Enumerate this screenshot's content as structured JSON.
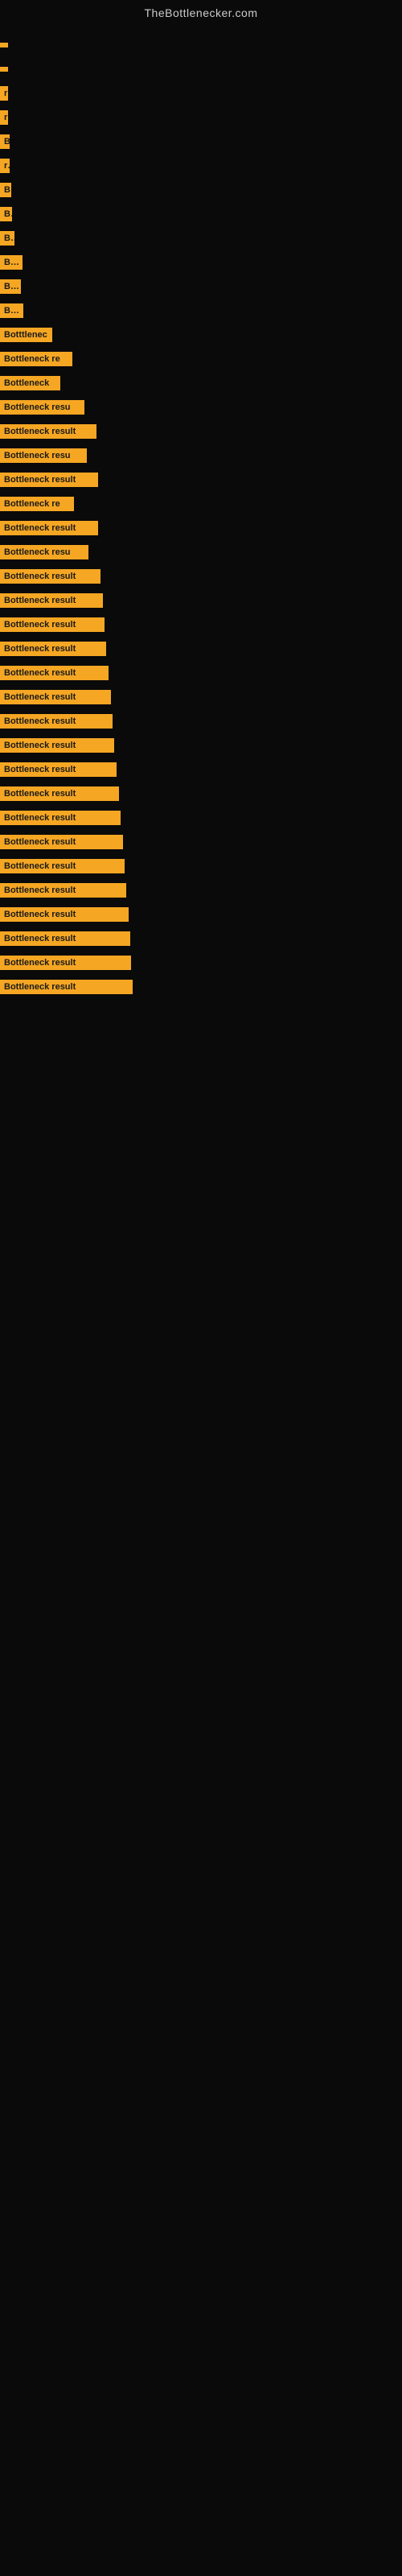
{
  "site": {
    "title": "TheBottlenecker.com"
  },
  "bars": [
    {
      "label": "",
      "width": 5
    },
    {
      "label": "",
      "width": 5
    },
    {
      "label": "r",
      "width": 10
    },
    {
      "label": "r",
      "width": 10
    },
    {
      "label": "B",
      "width": 12
    },
    {
      "label": "r",
      "width": 12
    },
    {
      "label": "B",
      "width": 14
    },
    {
      "label": "B",
      "width": 15
    },
    {
      "label": "Bo",
      "width": 18
    },
    {
      "label": "Bott",
      "width": 28
    },
    {
      "label": "Bot",
      "width": 26
    },
    {
      "label": "Bott",
      "width": 29
    },
    {
      "label": "Botttlenec",
      "width": 65
    },
    {
      "label": "Bottleneck re",
      "width": 90
    },
    {
      "label": "Bottleneck",
      "width": 75
    },
    {
      "label": "Bottleneck resu",
      "width": 105
    },
    {
      "label": "Bottleneck result",
      "width": 120
    },
    {
      "label": "Bottleneck resu",
      "width": 108
    },
    {
      "label": "Bottleneck result",
      "width": 122
    },
    {
      "label": "Bottleneck re",
      "width": 92
    },
    {
      "label": "Bottleneck result",
      "width": 122
    },
    {
      "label": "Bottleneck resu",
      "width": 110
    },
    {
      "label": "Bottleneck result",
      "width": 125
    },
    {
      "label": "Bottleneck result",
      "width": 128
    },
    {
      "label": "Bottleneck result",
      "width": 130
    },
    {
      "label": "Bottleneck result",
      "width": 132
    },
    {
      "label": "Bottleneck result",
      "width": 135
    },
    {
      "label": "Bottleneck result",
      "width": 138
    },
    {
      "label": "Bottleneck result",
      "width": 140
    },
    {
      "label": "Bottleneck result",
      "width": 142
    },
    {
      "label": "Bottleneck result",
      "width": 145
    },
    {
      "label": "Bottleneck result",
      "width": 148
    },
    {
      "label": "Bottleneck result",
      "width": 150
    },
    {
      "label": "Bottleneck result",
      "width": 153
    },
    {
      "label": "Bottleneck result",
      "width": 155
    },
    {
      "label": "Bottleneck result",
      "width": 157
    },
    {
      "label": "Bottleneck result",
      "width": 160
    },
    {
      "label": "Bottleneck result",
      "width": 162
    },
    {
      "label": "Bottleneck result",
      "width": 163
    },
    {
      "label": "Bottleneck result",
      "width": 165
    }
  ]
}
